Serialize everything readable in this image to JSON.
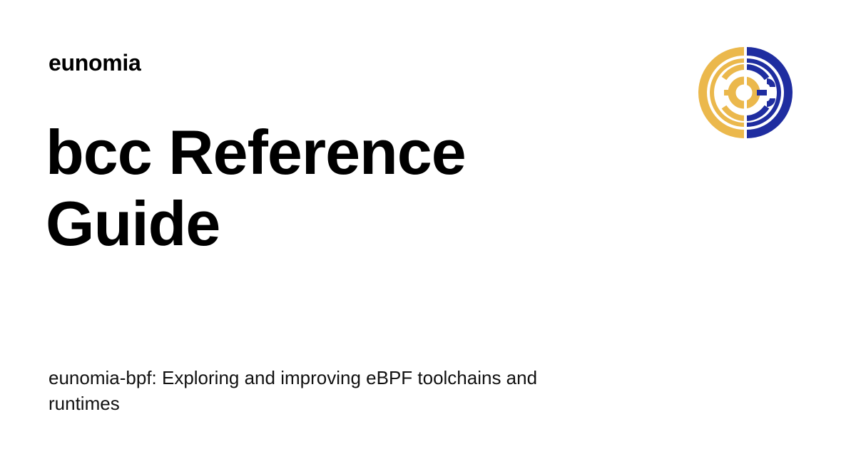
{
  "header": {
    "site_name": "eunomia"
  },
  "main": {
    "title": "bcc Reference Guide",
    "description": "eunomia-bpf: Exploring and improving eBPF toolchains and runtimes"
  },
  "logo": {
    "icon": "eunomia-logo-icon",
    "colors": {
      "left": "#EBB84C",
      "right": "#1F2DA0",
      "background": "#FFFFFF"
    }
  }
}
